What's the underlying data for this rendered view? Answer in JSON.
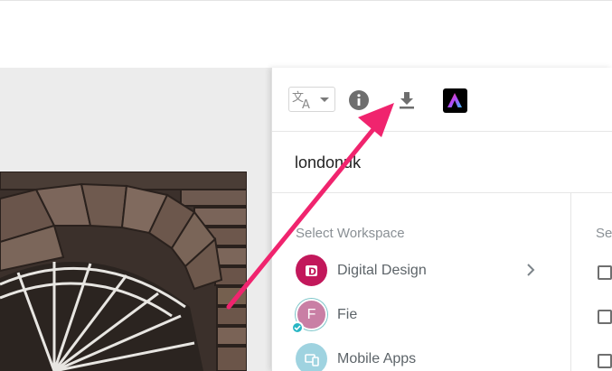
{
  "toolbar": {
    "translate_icon": "translate-icon",
    "info_icon": "info-icon",
    "download_icon": "download-icon",
    "adobe_express_icon": "adobe-express-icon"
  },
  "search": {
    "value": "londonuk"
  },
  "workspaces": {
    "heading": "Select Workspace",
    "items": [
      {
        "label": "Digital Design",
        "avatar": "D",
        "has_chevron": true
      },
      {
        "label": "Fie",
        "avatar": "F",
        "selected": true
      },
      {
        "label": "Mobile Apps",
        "avatar": ""
      }
    ]
  },
  "right_column": {
    "heading": "Se"
  },
  "colors": {
    "accent_arrow": "#f0246e",
    "avatar_digital_design": "#c2185b",
    "avatar_fie": "#c97fa5",
    "avatar_mobile_apps": "#9fd3e0",
    "check_badge": "#29b6c4"
  }
}
